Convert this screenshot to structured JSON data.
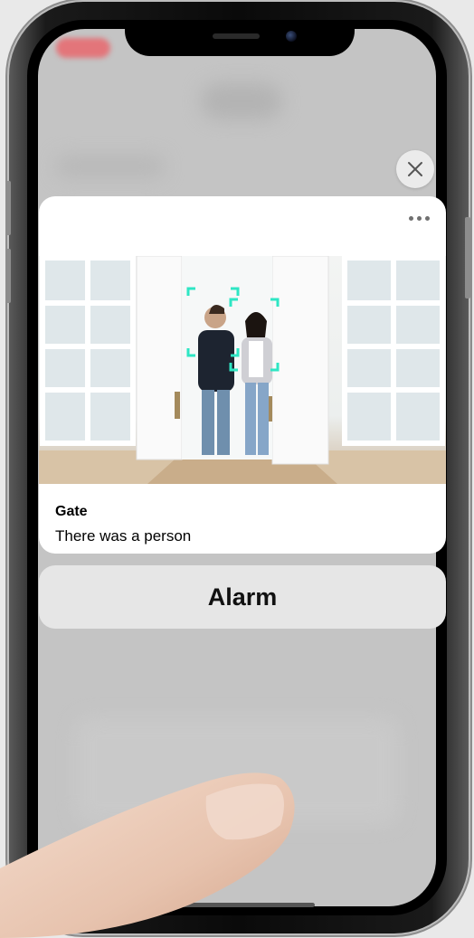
{
  "notification": {
    "title": "Gate",
    "message": "There was a person",
    "more_icon": "ellipsis-icon",
    "close_icon": "close-icon"
  },
  "snapshot": {
    "detections": 2,
    "detection_box_color": "#2ee6c4"
  },
  "actions": {
    "alarm_label": "Alarm"
  },
  "colors": {
    "screen_backdrop": "#c4c4c4",
    "card_background": "#ffffff",
    "action_button_background": "#e6e6e6"
  }
}
